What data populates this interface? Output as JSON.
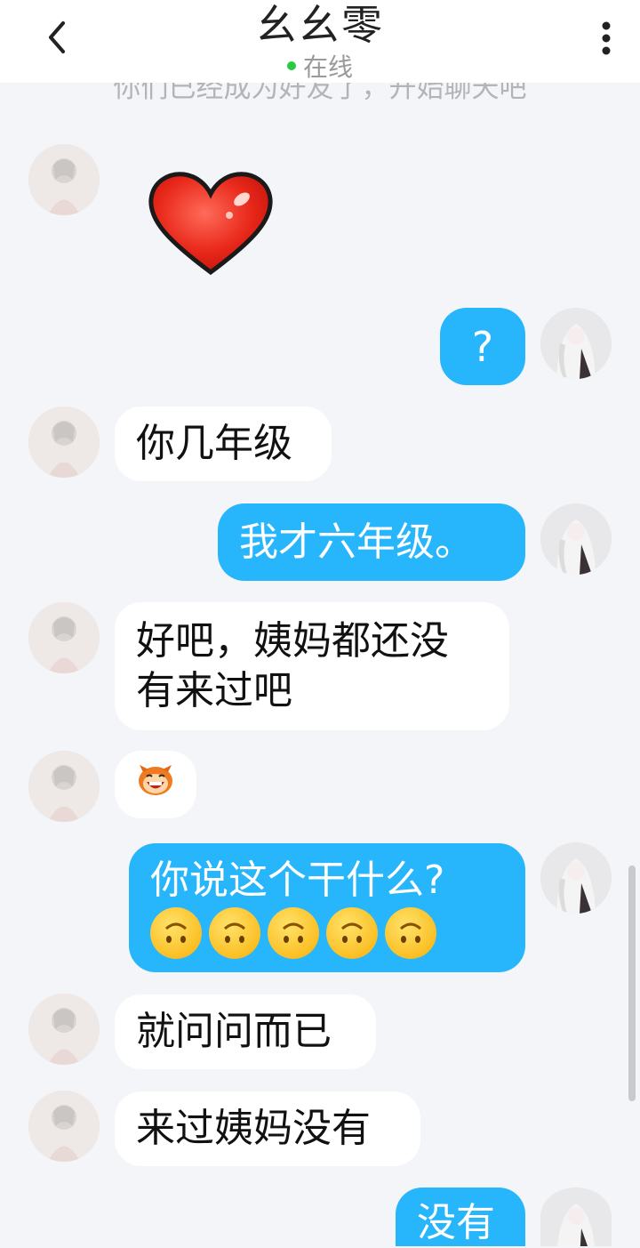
{
  "header": {
    "title": "幺幺零",
    "status": "在线"
  },
  "notice": "你们已经成为好友了，开始聊天吧",
  "messages": [
    {
      "from": "them",
      "kind": "sticker",
      "sticker": "red-heart"
    },
    {
      "from": "me",
      "kind": "text",
      "text": "?"
    },
    {
      "from": "them",
      "kind": "text",
      "text": "你几年级"
    },
    {
      "from": "me",
      "kind": "text",
      "text": "我才六年级。"
    },
    {
      "from": "them",
      "kind": "text",
      "lines": [
        "好吧，姨妈都还没",
        "有来过吧"
      ]
    },
    {
      "from": "them",
      "kind": "emoji",
      "emoji": "laughing-monkey"
    },
    {
      "from": "me",
      "kind": "text",
      "text": "你说这个干什么?",
      "emojis": [
        "upside-down-face",
        "upside-down-face",
        "upside-down-face",
        "upside-down-face",
        "upside-down-face"
      ]
    },
    {
      "from": "them",
      "kind": "text",
      "text": "就问问而已"
    },
    {
      "from": "them",
      "kind": "text",
      "text": "来过姨妈没有"
    },
    {
      "from": "me",
      "kind": "text",
      "text": "没有"
    }
  ],
  "icons": {
    "back": "chevron-left-icon",
    "more": "more-vertical-icon",
    "online": "online-dot-icon"
  },
  "colors": {
    "my_bubble": "#27b6fb",
    "their_bubble": "#ffffff",
    "background": "#f3f5f8",
    "online": "#29c940"
  }
}
